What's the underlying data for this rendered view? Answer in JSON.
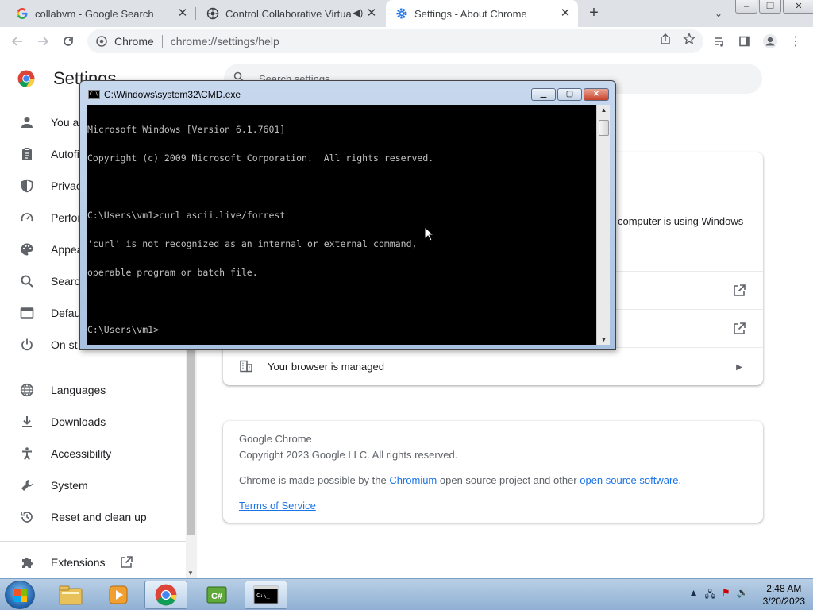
{
  "browser": {
    "tabs": [
      {
        "title": "collabvm - Google Search",
        "icon": "google-icon"
      },
      {
        "title": "Control Collaborative Virtual",
        "icon": "collabvm-icon",
        "audio": "speaker-muted-icon"
      },
      {
        "title": "Settings - About Chrome",
        "icon": "settings-gear-icon",
        "active": true
      }
    ],
    "omnibox": {
      "site_name": "Chrome",
      "url": "chrome://settings/help"
    }
  },
  "settings": {
    "title": "Settings",
    "search_placeholder": "Search settings",
    "nav": [
      {
        "label": "You a",
        "icon": "person-icon"
      },
      {
        "label": "Autofi",
        "icon": "clipboard-icon"
      },
      {
        "label": "Privac",
        "icon": "shield-icon"
      },
      {
        "label": "Perfor",
        "icon": "speedometer-icon"
      },
      {
        "label": "Appea",
        "icon": "palette-icon"
      },
      {
        "label": "Searc",
        "icon": "search-icon"
      },
      {
        "label": "Defau",
        "icon": "browser-window-icon"
      },
      {
        "label": "On st",
        "icon": "power-icon"
      },
      {
        "label": "Languages",
        "icon": "globe-icon"
      },
      {
        "label": "Downloads",
        "icon": "download-icon"
      },
      {
        "label": "Accessibility",
        "icon": "accessibility-icon"
      },
      {
        "label": "System",
        "icon": "wrench-icon"
      },
      {
        "label": "Reset and clean up",
        "icon": "history-reset-icon"
      },
      {
        "label": "Extensions",
        "icon": "puzzle-icon"
      }
    ],
    "about_card": {
      "partial_text": "computer is using Windows",
      "managed_label": "Your browser is managed"
    },
    "info_card": {
      "product": "Google Chrome",
      "copyright": "Copyright 2023 Google LLC. All rights reserved.",
      "made_possible_prefix": "Chrome is made possible by the ",
      "chromium_link": "Chromium",
      "made_possible_middle": " open source project and other ",
      "oss_link": "open source software",
      "made_possible_suffix": ".",
      "tos_link": "Terms of Service"
    }
  },
  "cmd": {
    "title": "C:\\Windows\\system32\\CMD.exe",
    "lines": [
      "Microsoft Windows [Version 6.1.7601]",
      "Copyright (c) 2009 Microsoft Corporation.  All rights reserved.",
      "",
      "C:\\Users\\vm1>curl ascii.live/forrest",
      "'curl' is not recognized as an internal or external command,",
      "operable program or batch file.",
      "",
      "C:\\Users\\vm1>"
    ]
  },
  "taskbar": {
    "items": [
      {
        "name": "explorer-taskbar-icon"
      },
      {
        "name": "media-player-taskbar-icon"
      },
      {
        "name": "chrome-taskbar-icon",
        "active": true
      },
      {
        "name": "csharp-taskbar-icon"
      },
      {
        "name": "cmd-taskbar-icon",
        "active": true
      }
    ],
    "time": "2:48 AM",
    "date": "3/20/2023"
  },
  "colors": {
    "accent": "#1a73e8",
    "tabstrip": "#dee1e6",
    "console_bg": "#000000",
    "console_fg": "#c0c0c0"
  }
}
